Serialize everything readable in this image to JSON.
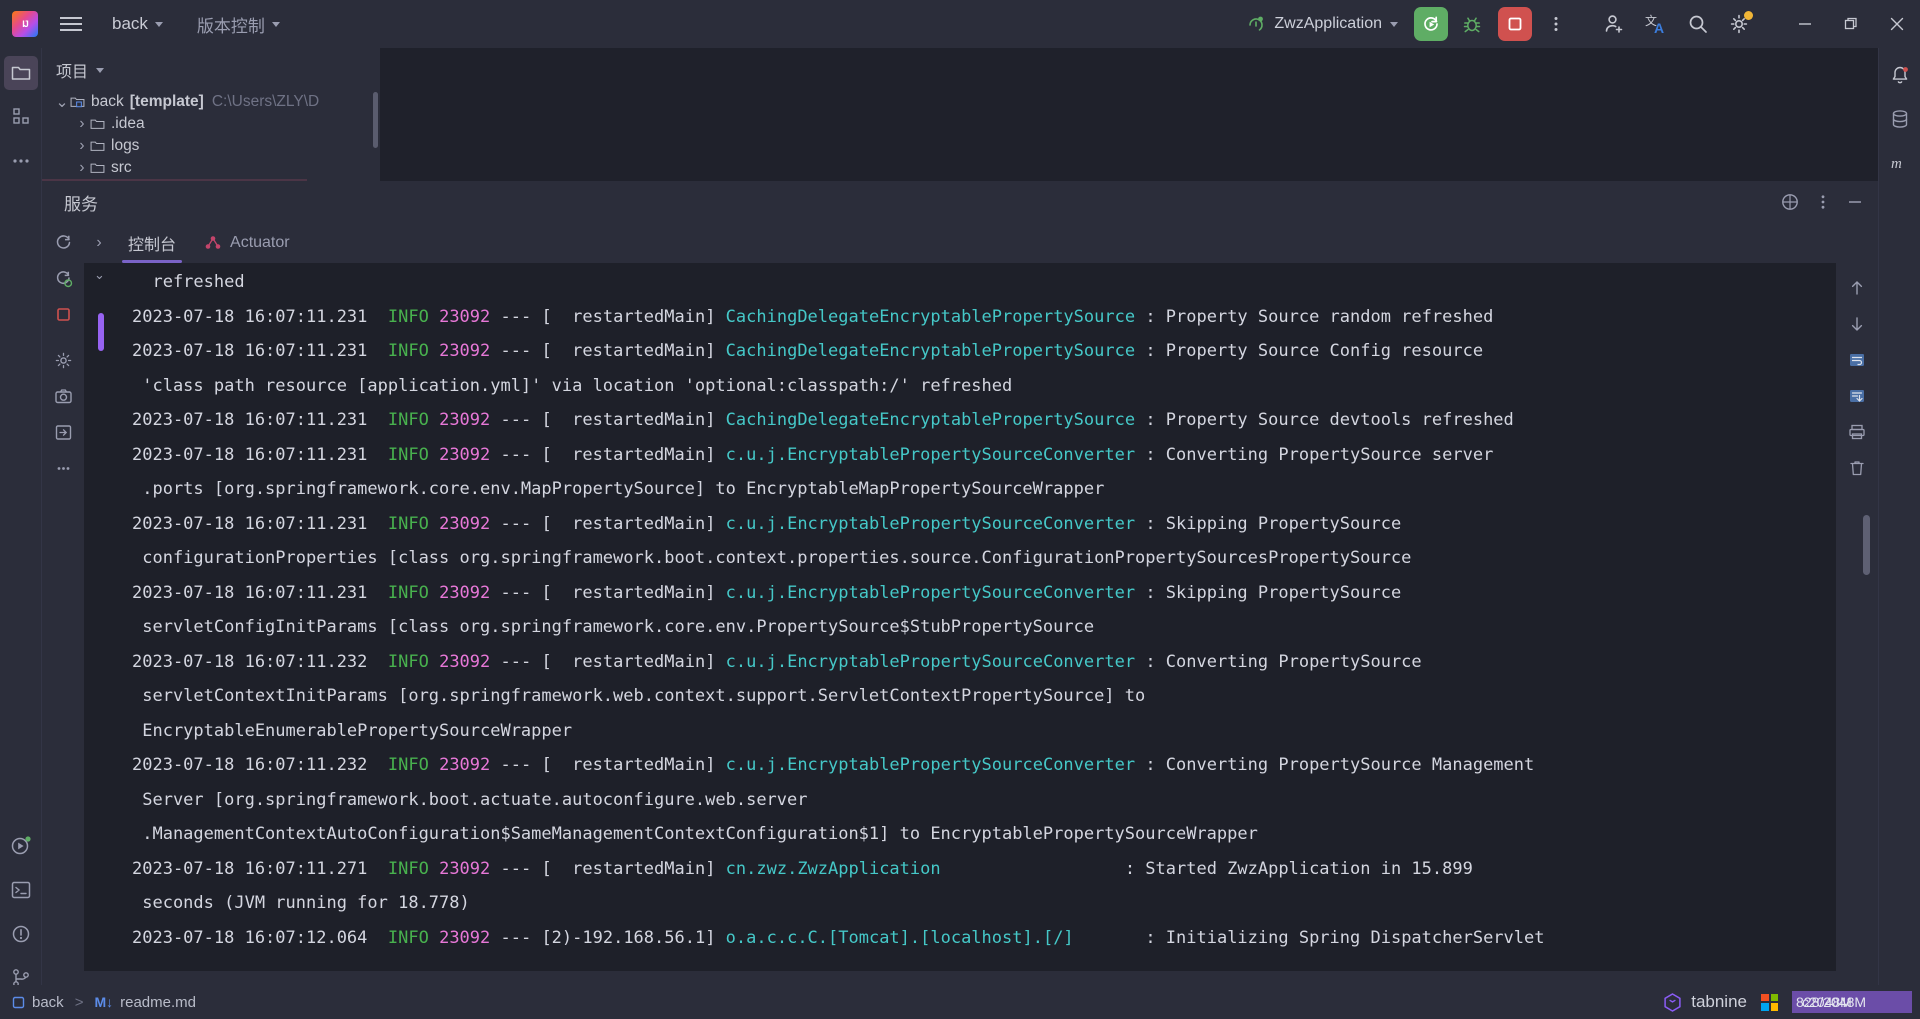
{
  "titlebar": {
    "menu_icon": "hamburger-menu-icon",
    "project_name": "back",
    "vcs_label": "版本控制",
    "run_config": "ZwzApplication",
    "run_icon": "rerun-icon",
    "debug_icon": "debug-bug-icon",
    "stop_icon": "stop-square-icon",
    "more_icon": "more-vertical-icon",
    "add_user_icon": "add-user-icon",
    "translate_icon": "translate-icon",
    "search_icon": "search-icon",
    "settings_icon": "gear-icon",
    "minimize_icon": "minimize-icon",
    "restore_icon": "restore-icon",
    "close_icon": "close-icon"
  },
  "left_rail": {
    "items": [
      {
        "name": "project-tool-icon",
        "label": "Project"
      },
      {
        "name": "structure-tool-icon",
        "label": "Structure"
      },
      {
        "name": "more-tools-icon",
        "label": "More"
      }
    ],
    "bottom_items": [
      {
        "name": "run-tool-icon",
        "label": "Run"
      },
      {
        "name": "terminal-tool-icon",
        "label": "Terminal"
      },
      {
        "name": "problems-tool-icon",
        "label": "Problems"
      },
      {
        "name": "git-branch-tool-icon",
        "label": "Git"
      }
    ]
  },
  "right_rail": {
    "items": [
      {
        "name": "notifications-icon",
        "label": "Notifications"
      },
      {
        "name": "database-icon",
        "label": "Database"
      },
      {
        "name": "maven-icon",
        "label": "Maven"
      }
    ]
  },
  "project_panel": {
    "title": "项目",
    "tree": [
      {
        "label": "back",
        "suffix": "[template]",
        "path": "C:\\Users\\ZLY\\D",
        "expanded": true,
        "depth": 0,
        "selected": false
      },
      {
        "label": ".idea",
        "suffix": "",
        "path": "",
        "expanded": false,
        "depth": 1,
        "selected": false
      },
      {
        "label": "logs",
        "suffix": "",
        "path": "",
        "expanded": false,
        "depth": 1,
        "selected": false
      },
      {
        "label": "src",
        "suffix": "",
        "path": "",
        "expanded": false,
        "depth": 1,
        "selected": false
      },
      {
        "label": "",
        "suffix": "",
        "path": "",
        "expanded": false,
        "depth": 1,
        "selected": true
      }
    ]
  },
  "services": {
    "title": "服务",
    "header_icons": [
      "help-circle-icon",
      "more-vertical-icon",
      "minimize-icon"
    ],
    "rail_icons": [
      "rerun-icon",
      "rerun-failed-icon",
      "stop-icon",
      "settings-icon",
      "camera-icon",
      "export-icon",
      "more-vertical-icon"
    ],
    "tabs": [
      {
        "label": "控制台",
        "icon": "",
        "active": true
      },
      {
        "label": "Actuator",
        "icon": "actuator-graph-icon",
        "active": false
      }
    ],
    "right_rail_icons": [
      "scroll-up-icon",
      "scroll-down-icon",
      "soft-wrap-icon",
      "scroll-to-end-icon",
      "print-icon",
      "trash-icon"
    ]
  },
  "console": {
    "lines": [
      [
        {
          "t": "  refreshed",
          "c": "white"
        }
      ],
      [
        {
          "t": "2023-07-18 16:07:11.231 ",
          "c": "white"
        },
        {
          "t": " INFO",
          "c": "info"
        },
        {
          "t": " ",
          "c": "white"
        },
        {
          "t": "23092",
          "c": "pid"
        },
        {
          "t": " --- [  restartedMain] ",
          "c": "white"
        },
        {
          "t": "CachingDelegateEncryptablePropertySource",
          "c": "class"
        },
        {
          "t": " : Property Source random refreshed",
          "c": "white"
        }
      ],
      [
        {
          "t": "2023-07-18 16:07:11.231 ",
          "c": "white"
        },
        {
          "t": " INFO",
          "c": "info"
        },
        {
          "t": " ",
          "c": "white"
        },
        {
          "t": "23092",
          "c": "pid"
        },
        {
          "t": " --- [  restartedMain] ",
          "c": "white"
        },
        {
          "t": "CachingDelegateEncryptablePropertySource",
          "c": "class"
        },
        {
          "t": " : Property Source Config resource",
          "c": "white"
        }
      ],
      [
        {
          "t": " 'class path resource [application.yml]' via location 'optional:classpath:/' refreshed",
          "c": "white"
        }
      ],
      [
        {
          "t": "2023-07-18 16:07:11.231 ",
          "c": "white"
        },
        {
          "t": " INFO",
          "c": "info"
        },
        {
          "t": " ",
          "c": "white"
        },
        {
          "t": "23092",
          "c": "pid"
        },
        {
          "t": " --- [  restartedMain] ",
          "c": "white"
        },
        {
          "t": "CachingDelegateEncryptablePropertySource",
          "c": "class"
        },
        {
          "t": " : Property Source devtools refreshed",
          "c": "white"
        }
      ],
      [
        {
          "t": "2023-07-18 16:07:11.231 ",
          "c": "white"
        },
        {
          "t": " INFO",
          "c": "info"
        },
        {
          "t": " ",
          "c": "white"
        },
        {
          "t": "23092",
          "c": "pid"
        },
        {
          "t": " --- [  restartedMain] ",
          "c": "white"
        },
        {
          "t": "c.u.j.EncryptablePropertySourceConverter",
          "c": "class"
        },
        {
          "t": " : Converting PropertySource server",
          "c": "white"
        }
      ],
      [
        {
          "t": " .ports [org.springframework.core.env.MapPropertySource] to EncryptableMapPropertySourceWrapper",
          "c": "white"
        }
      ],
      [
        {
          "t": "2023-07-18 16:07:11.231 ",
          "c": "white"
        },
        {
          "t": " INFO",
          "c": "info"
        },
        {
          "t": " ",
          "c": "white"
        },
        {
          "t": "23092",
          "c": "pid"
        },
        {
          "t": " --- [  restartedMain] ",
          "c": "white"
        },
        {
          "t": "c.u.j.EncryptablePropertySourceConverter",
          "c": "class"
        },
        {
          "t": " : Skipping PropertySource",
          "c": "white"
        }
      ],
      [
        {
          "t": " configurationProperties [class org.springframework.boot.context.properties.source.ConfigurationPropertySourcesPropertySource",
          "c": "white"
        }
      ],
      [
        {
          "t": "2023-07-18 16:07:11.231 ",
          "c": "white"
        },
        {
          "t": " INFO",
          "c": "info"
        },
        {
          "t": " ",
          "c": "white"
        },
        {
          "t": "23092",
          "c": "pid"
        },
        {
          "t": " --- [  restartedMain] ",
          "c": "white"
        },
        {
          "t": "c.u.j.EncryptablePropertySourceConverter",
          "c": "class"
        },
        {
          "t": " : Skipping PropertySource",
          "c": "white"
        }
      ],
      [
        {
          "t": " servletConfigInitParams [class org.springframework.core.env.PropertySource$StubPropertySource",
          "c": "white"
        }
      ],
      [
        {
          "t": "2023-07-18 16:07:11.232 ",
          "c": "white"
        },
        {
          "t": " INFO",
          "c": "info"
        },
        {
          "t": " ",
          "c": "white"
        },
        {
          "t": "23092",
          "c": "pid"
        },
        {
          "t": " --- [  restartedMain] ",
          "c": "white"
        },
        {
          "t": "c.u.j.EncryptablePropertySourceConverter",
          "c": "class"
        },
        {
          "t": " : Converting PropertySource",
          "c": "white"
        }
      ],
      [
        {
          "t": " servletContextInitParams [org.springframework.web.context.support.ServletContextPropertySource] to",
          "c": "white"
        }
      ],
      [
        {
          "t": " EncryptableEnumerablePropertySourceWrapper",
          "c": "white"
        }
      ],
      [
        {
          "t": "2023-07-18 16:07:11.232 ",
          "c": "white"
        },
        {
          "t": " INFO",
          "c": "info"
        },
        {
          "t": " ",
          "c": "white"
        },
        {
          "t": "23092",
          "c": "pid"
        },
        {
          "t": " --- [  restartedMain] ",
          "c": "white"
        },
        {
          "t": "c.u.j.EncryptablePropertySourceConverter",
          "c": "class"
        },
        {
          "t": " : Converting PropertySource Management",
          "c": "white"
        }
      ],
      [
        {
          "t": " Server [org.springframework.boot.actuate.autoconfigure.web.server",
          "c": "white"
        }
      ],
      [
        {
          "t": " .ManagementContextAutoConfiguration$SameManagementContextConfiguration$1] to EncryptablePropertySourceWrapper",
          "c": "white"
        }
      ],
      [
        {
          "t": "2023-07-18 16:07:11.271 ",
          "c": "white"
        },
        {
          "t": " INFO",
          "c": "info"
        },
        {
          "t": " ",
          "c": "white"
        },
        {
          "t": "23092",
          "c": "pid"
        },
        {
          "t": " --- [  restartedMain] ",
          "c": "white"
        },
        {
          "t": "cn.zwz.ZwzApplication",
          "c": "class"
        },
        {
          "t": "                  : Started ZwzApplication in 15.899",
          "c": "white"
        }
      ],
      [
        {
          "t": " seconds (JVM running for 18.778)",
          "c": "white"
        }
      ],
      [
        {
          "t": "2023-07-18 16:07:12.064 ",
          "c": "white"
        },
        {
          "t": " INFO",
          "c": "info"
        },
        {
          "t": " ",
          "c": "white"
        },
        {
          "t": "23092",
          "c": "pid"
        },
        {
          "t": " --- [2)-192.168.56.1] ",
          "c": "white"
        },
        {
          "t": "o.a.c.c.C.[Tomcat].[localhost].[/]",
          "c": "class"
        },
        {
          "t": "       : Initializing Spring DispatcherServlet",
          "c": "white"
        }
      ]
    ]
  },
  "status_bar": {
    "breadcrumb_project": "back",
    "breadcrumb_sep": ">",
    "breadcrumb_file": "readme.md",
    "md_badge": "M↓",
    "tabnine_label": "tabnine",
    "memory_1": "828/2048M",
    "memory_2": "c2048M"
  },
  "colors": {
    "accent_purple": "#7a63c7",
    "run_green": "#5fad65",
    "stop_red": "#d0514f",
    "info_green": "#48b14e",
    "pid_pink": "#e878d8",
    "class_cyan": "#45c8c8",
    "panel_bg": "#2b2d3a",
    "console_bg": "#1e2029"
  }
}
